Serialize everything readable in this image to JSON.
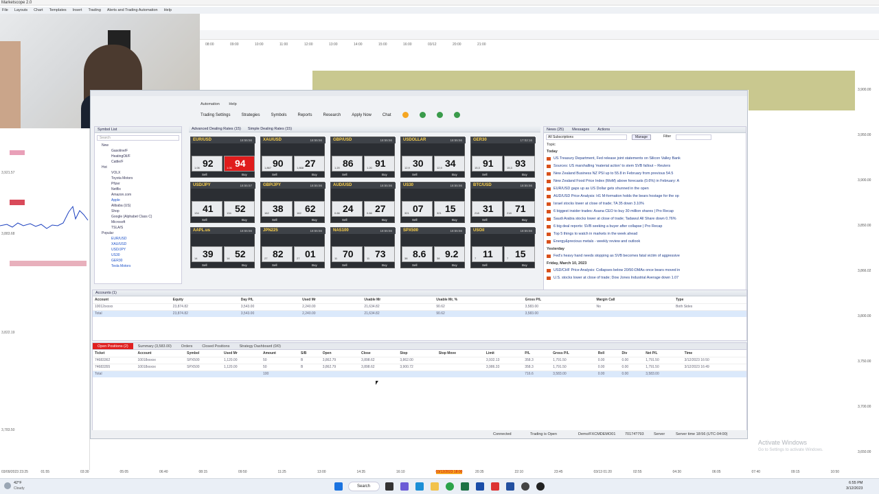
{
  "app_title": "Marketscope 2.0",
  "menu": [
    "File",
    "Layouts",
    "Chart",
    "Templates",
    "Insert",
    "Trading",
    "Alerts and Trading Automation",
    "Help"
  ],
  "bg_time_axis": [
    "08:00",
    "09:00",
    "10:00",
    "11:00",
    "12:00",
    "13:00",
    "14:00",
    "15:00",
    "16:00",
    "03/12",
    "20:00",
    "21:00"
  ],
  "window": {
    "submenu": [
      "Automation",
      "Help"
    ],
    "toolbar": [
      "Trading Settings",
      "Strategies",
      "Symbols",
      "Reports",
      "Research",
      "Apply Now",
      "Chat"
    ],
    "symbol_panel_title": "Symbol List",
    "symbol_search_placeholder": "Search",
    "symbol_groups": [
      {
        "label": "New",
        "items": [
          "Gasoline/F",
          "HeatingOil/F",
          "Cattle/F"
        ]
      },
      {
        "label": "Hot",
        "items": [
          "VOLX",
          "Toyota Motors",
          "Pfizer",
          "Netflix",
          "Amazon.com",
          "Apple",
          "Alibaba (US)",
          "Shop",
          "Google (Alphabet Class C)",
          "Microsoft",
          "TSLA/S"
        ]
      },
      {
        "label": "Popular",
        "items": [
          "EUR/USD",
          "XAU/USD",
          "USD/JPY",
          "US30",
          "GER30",
          "Tesla Motors"
        ]
      }
    ],
    "rates_tabs": [
      "Advanced Dealing Rates (15)",
      "Simple Dealing Rates (15)"
    ],
    "tiles": [
      {
        "name": "EUR/USD",
        "time": "18:55:56",
        "sell_big": "1.06",
        "sell": "92",
        "buy": "94",
        "buy_big": "1.06",
        "hot": true
      },
      {
        "name": "XAU/USD",
        "time": "18:55:56",
        "sell_big": "1,867",
        "sell": "90",
        "buy": "27",
        "buy_big": "1,868",
        "hot": false
      },
      {
        "name": "GBP/USD",
        "time": "18:55:56",
        "sell_big": "1.20",
        "sell": "86",
        "buy": "91",
        "buy_big": "1.20",
        "hot": false
      },
      {
        "name": "USDOLLAR",
        "time": "18:55:56",
        "sell_big": "12,9",
        "sell": "30",
        "buy": "34",
        "buy_big": "12,9",
        "hot": false
      },
      {
        "name": "GER30",
        "time": "17:02:16",
        "sell_big": "15,3",
        "sell": "91",
        "buy": "93",
        "buy_big": "15,3",
        "hot": false
      },
      {
        "name": "USD/JPY",
        "time": "18:55:57",
        "sell_big": "134",
        "sell": "41",
        "buy": "52",
        "buy_big": "134",
        "hot": false
      },
      {
        "name": "GBP/JPY",
        "time": "18:55:56",
        "sell_big": "162",
        "sell": "38",
        "buy": "62",
        "buy_big": "162",
        "hot": false
      },
      {
        "name": "AUD/USD",
        "time": "18:55:56",
        "sell_big": "0.66",
        "sell": "24",
        "buy": "27",
        "buy_big": "0.66",
        "hot": false
      },
      {
        "name": "US30",
        "time": "18:55:56",
        "sell_big": "321",
        "sell": "07",
        "buy": "15",
        "buy_big": "321",
        "hot": false
      },
      {
        "name": "BTC/USD",
        "time": "18:55:56",
        "sell_big": "218",
        "sell": "31",
        "buy": "71",
        "buy_big": "218",
        "hot": false
      },
      {
        "name": "AAPL.us",
        "time": "18:55:56",
        "sell_big": "14",
        "sell": "39",
        "buy": "52",
        "buy_big": "14",
        "hot": false
      },
      {
        "name": "JPN225",
        "time": "18:55:56",
        "sell_big": "27",
        "sell": "82",
        "buy": "01",
        "buy_big": "27",
        "hot": false
      },
      {
        "name": "NAS100",
        "time": "18:55:56",
        "sell_big": "11",
        "sell": "70",
        "buy": "73",
        "buy_big": "11",
        "hot": false
      },
      {
        "name": "SPX500",
        "time": "18:55:56",
        "sell_big": "38",
        "sell": "8.6",
        "buy": "9.2",
        "buy_big": "38",
        "hot": false
      },
      {
        "name": "USOil",
        "time": "18:55:56",
        "sell_big": "7",
        "sell": "11",
        "buy": "15",
        "buy_big": "7",
        "hot": false
      }
    ],
    "sell_label": "Sell",
    "buy_label": "Buy",
    "news_tabs": [
      "News (25)",
      "Messages",
      "Actions"
    ],
    "news_filter": "All Subscriptions",
    "news_manage": "Manage",
    "news_filter_label": "Filter",
    "news_topic": "Topic",
    "news_today": "Today",
    "news_items": [
      "US Treasury Department, Fed release joint statements on Silicon Valley Bank",
      "Sources: US marshalling 'material action' to stem SVB fallout – Reuters",
      "New Zealand Business NZ PSI up to 55.8 in February from previous 54.5",
      "New Zealand Food Price Index (MoM) above forecasts (0.6%) in February: A",
      "EUR/USD gaps up as US Dollar gets shunned in the open",
      "AUD/USD Price Analysis: H1 M-formation holds the bears hostage for the op",
      "Israel stocks lower at close of trade; TA 35 down 3.10%",
      "6 biggest insider trades: Asana CEO to buy 30 million shares | Pro Recap",
      "Saudi Arabia stocks lower at close of trade; Tadawul All Share down 0.76%",
      "6 big deal reports: SVB seeking a buyer after collapse | Pro Recap",
      "Top 5 things to watch in markets in the week ahead",
      "Energy&precious metals - weekly review and outlook"
    ],
    "news_yesterday": "Yesterday",
    "news_items_y": [
      "Fed's heavy hand needs stopping as SVB becomes fatal victim of aggressive"
    ],
    "news_date": "Friday, March 10, 2023",
    "news_items_f": [
      "USD/CHF Price Analysis: Collapses below 20/50-DMAs once bears moved in",
      "U.S. stocks lower at close of trade; Dow Jones Industrial Average down 1.07"
    ],
    "accounts_title": "Accounts (1)",
    "accounts_cols": [
      "Account",
      "Equity",
      "Day P/L",
      "Used Mr",
      "Usable Mr",
      "Usable Mr, %",
      "Gross P/L",
      "Margin Call",
      "Type"
    ],
    "accounts_row": [
      "10012xxxxx",
      "23,874.82",
      "3,543.00",
      "2,240.00",
      "21,634.82",
      "90.62",
      "3,583.00",
      "No",
      "Both Sides"
    ],
    "accounts_total": [
      "Total",
      "23,874.82",
      "3,543.00",
      "2,240.00",
      "21,634.82",
      "90.62",
      "3,583.00",
      "",
      ""
    ],
    "pos_tabs": [
      "Open Positions (2)",
      "Summary (3,583.00)",
      "Orders",
      "Closed Positions",
      "Strategy Dashboard (0/0)"
    ],
    "pos_cols": [
      "Ticket",
      "Account",
      "Symbol",
      "Used Mr",
      "Amount",
      "S/B",
      "Open",
      "Close",
      "Stop",
      "Stop Move",
      "Limit",
      "P/L",
      "Gross P/L",
      "Roll",
      "Div",
      "Net P/L",
      "Time"
    ],
    "pos_rows": [
      [
        "74683362",
        "10018xxxxx",
        "SPX500",
        "1,120.00",
        "50",
        "B",
        "3,862.79",
        "3,898.62",
        "3,862.00",
        "",
        "3,932.13",
        "358.3",
        "1,791.50",
        "0.00",
        "0.00",
        "1,791.50",
        "3/12/2023 16:50"
      ],
      [
        "74683355",
        "10018xxxxx",
        "SPX500",
        "1,120.00",
        "50",
        "B",
        "3,862.79",
        "3,898.62",
        "3,900.72",
        "",
        "3,986.33",
        "358.3",
        "1,791.50",
        "0.00",
        "0.00",
        "1,791.50",
        "3/12/2023 16:49"
      ]
    ],
    "pos_total": [
      "Total",
      "",
      "",
      "",
      "100",
      "",
      "",
      "",
      "",
      "",
      "",
      "716.6",
      "3,583.00",
      "0.00",
      "0.00",
      "3,583.00",
      ""
    ],
    "status": {
      "connected": "Connected",
      "trading": "Trading is Open",
      "account": "Demo/FXCMDEMO01",
      "session": "70174?793",
      "server": "Server",
      "server_time": "Server time 18:56 (UTC-04:00)"
    }
  },
  "left_labels": [
    "3,921.57",
    "3,883.68",
    "3,822.19",
    "3,783.50"
  ],
  "right_labels": [
    "3,900.00",
    "3,950.00",
    "3,900.00",
    "3,850.00",
    "3,866.02",
    "3,800.00",
    "3,750.00",
    "3,700.00",
    "3,650.00"
  ],
  "bottom_axis": [
    "03/09/2023 23:25",
    "01:55",
    "03:30",
    "05:05",
    "06:40",
    "08:15",
    "09:50",
    "11:25",
    "13:00",
    "14:35",
    "16:10",
    "03/12/2023 18:00",
    "20:35",
    "22:10",
    "23:45",
    "03/13 01:20",
    "02:55",
    "04:30",
    "06:05",
    "07:40",
    "09:15",
    "10:50"
  ],
  "watermark": {
    "title": "Activate Windows",
    "sub": "Go to Settings to activate Windows."
  },
  "taskbar": {
    "weather": "42°F",
    "weather_sub": "Cloudy",
    "search": "Search",
    "time": "6:55 PM",
    "date": "3/12/2023"
  }
}
